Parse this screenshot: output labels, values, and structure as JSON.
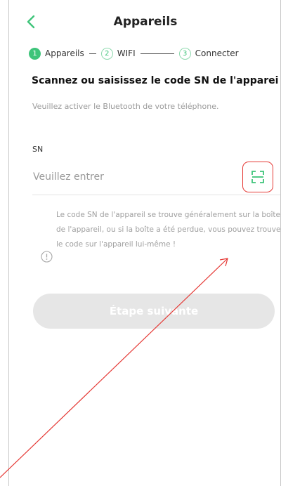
{
  "header": {
    "title": "Appareils",
    "back_icon": "chevron-left-icon"
  },
  "steps": [
    {
      "number": "1",
      "label": "Appareils",
      "active": true
    },
    {
      "number": "2",
      "label": "WIFI",
      "active": false
    },
    {
      "number": "3",
      "label": "Connecter",
      "active": false
    }
  ],
  "heading": "Scannez ou saisissez le code SN de l'apparei",
  "subtext": "Veuillez activer le Bluetooth de votre téléphone.",
  "sn": {
    "label": "SN",
    "placeholder": "Veuillez entrer",
    "value": "",
    "scan_icon": "scan-icon"
  },
  "info": {
    "icon": "info-icon",
    "text": "Le code SN de l'appareil se trouve généralement sur la boîte de l'appareil, ou si la boîte a été perdue, vous pouvez trouver le code sur l'appareil lui-même !"
  },
  "next_button": {
    "label": "Étape suivante",
    "enabled": false
  },
  "colors": {
    "accent": "#3ec47a",
    "annotation": "#e53935",
    "disabled_button": "#e6e6e6"
  }
}
